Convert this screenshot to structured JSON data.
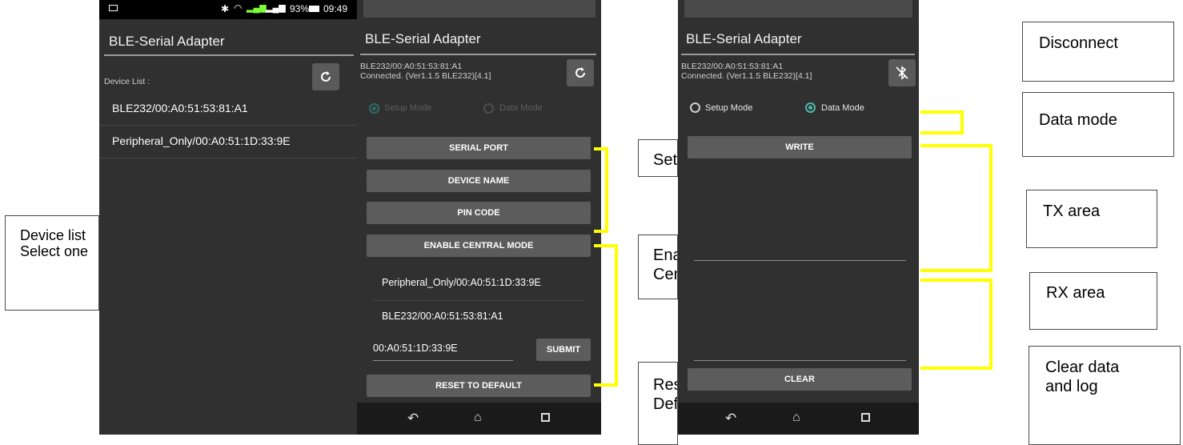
{
  "app_title": "BLE-Serial Adapter",
  "status_bar": {
    "battery": "93%",
    "time": "09:49"
  },
  "screen1": {
    "device_list_label": "Device List :",
    "devices": [
      "BLE232/00:A0:51:53:81:A1",
      "Peripheral_Only/00:A0:51:1D:33:9E"
    ]
  },
  "screen2": {
    "conn_line1": "BLE232/00:A0:51:53:81:A1",
    "conn_line2": "Connected. (Ver1.1.5 BLE232)[4.1]",
    "setup_mode": "Setup Mode",
    "data_mode": "Data Mode",
    "serial_port": "SERIAL PORT",
    "device_name": "DEVICE NAME",
    "pin_code": "PIN CODE",
    "enable_central": "ENABLE CENTRAL MODE",
    "peer_devices": [
      "Peripheral_Only/00:A0:51:1D:33:9E",
      "BLE232/00:A0:51:53:81:A1"
    ],
    "address_input": "00:A0:51:1D:33:9E",
    "submit": "SUBMIT",
    "reset": "RESET TO DEFAULT"
  },
  "screen3": {
    "conn_line1": "BLE232/00:A0:51:53:81:A1",
    "conn_line2": "Connected. (Ver1.1.5 BLE232)[4.1]",
    "setup_mode": "Setup Mode",
    "data_mode": "Data Mode",
    "write": "WRITE",
    "clear": "CLEAR"
  },
  "callouts": {
    "device_list": [
      "Device list",
      "Select one"
    ],
    "setup": "Setup",
    "enable_central": [
      "Enable",
      "Central"
    ],
    "reset": [
      "Reset to",
      "Default"
    ],
    "disconnect": "Disconnect",
    "data_mode": "Data mode",
    "tx_area": "TX area",
    "rx_area": "RX area",
    "clear": [
      "Clear data",
      "and log"
    ]
  },
  "colors": {
    "phone_bg": "#303030",
    "button_bg": "#5c5c5c",
    "accent": "#4db6ac",
    "highlight": "#ffff00"
  }
}
